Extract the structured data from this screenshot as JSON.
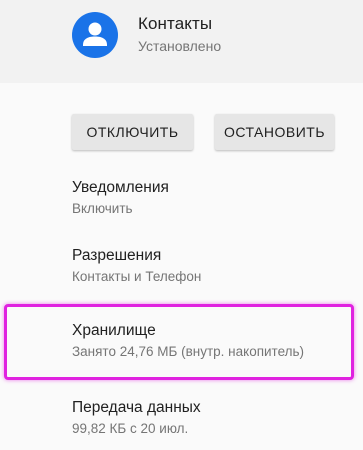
{
  "app": {
    "name": "Контакты",
    "status": "Установлено",
    "icon": "contact-person-icon",
    "icon_color": "#1a73e8"
  },
  "buttons": {
    "disable": "ОТКЛЮЧИТЬ",
    "stop": "ОСТАНОВИТЬ"
  },
  "settings": [
    {
      "title": "Уведомления",
      "subtitle": "Включить"
    },
    {
      "title": "Разрешения",
      "subtitle": "Контакты и Телефон"
    },
    {
      "title": "Хранилище",
      "subtitle": "Занято 24,76 МБ (внутр. накопитель)"
    },
    {
      "title": "Передача данных",
      "subtitle": "99,82 КБ с 20 июл."
    }
  ],
  "highlight_color": "#e022e0"
}
